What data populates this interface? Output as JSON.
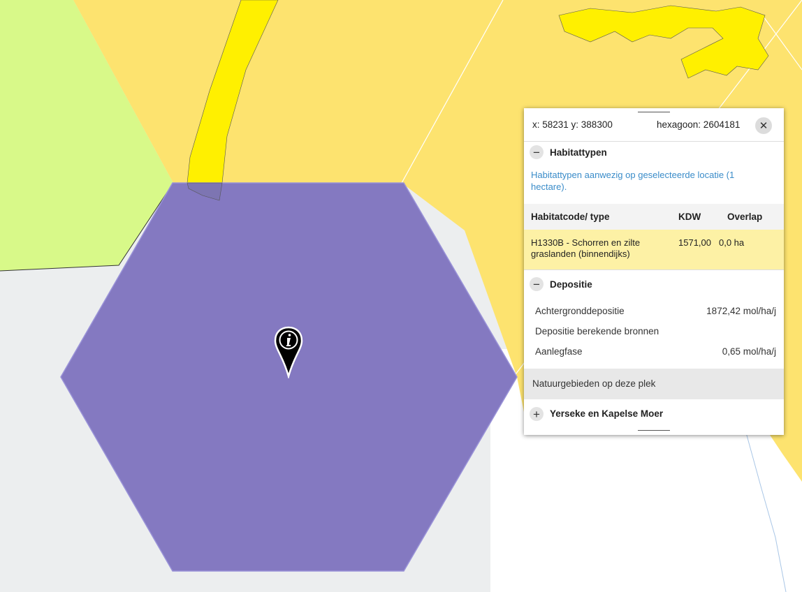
{
  "map": {
    "colors": {
      "grey_area": "#eceeef",
      "green_area": "#d8f989",
      "yellow_area": "#fde36f",
      "bright_yellow": "#fff000",
      "hexagon": "#8479c1",
      "hexagon_border": "#9a93d8",
      "water_line": "#a9c6e6"
    },
    "marker_icon": "info-pin-icon"
  },
  "info_panel": {
    "coordinates": "x: 58231 y: 388300",
    "hexagon": "hexagoon: 2604181",
    "close_icon": "close-icon",
    "habitat": {
      "title": "Habitattypen",
      "toggle_symbol": "−",
      "description": "Habitattypen aanwezig op geselecteerde locatie (1 hectare).",
      "columns": {
        "code": "Habitatcode/ type",
        "kdw": "KDW",
        "overlap": "Overlap"
      },
      "rows": [
        {
          "line1": "H1330B - Schorren en zilte",
          "line2": "graslanden (binnendijks)",
          "kdw": "1571,00",
          "overlap": "0,0 ha",
          "highlight": "#fdf1a5"
        }
      ]
    },
    "deposition": {
      "title": "Depositie",
      "toggle_symbol": "−",
      "rows": [
        {
          "label": "Achtergronddepositie",
          "value": "1872,42 mol/ha/j"
        },
        {
          "label": "Depositie berekende bronnen",
          "value": ""
        },
        {
          "label": "Aanlegfase",
          "value": "0,65 mol/ha/j"
        }
      ]
    },
    "nature_areas": {
      "header": "Natuurgebieden op deze plek",
      "items": [
        {
          "label": "Yerseke en Kapelse Moer",
          "toggle_symbol": "+"
        }
      ]
    }
  }
}
